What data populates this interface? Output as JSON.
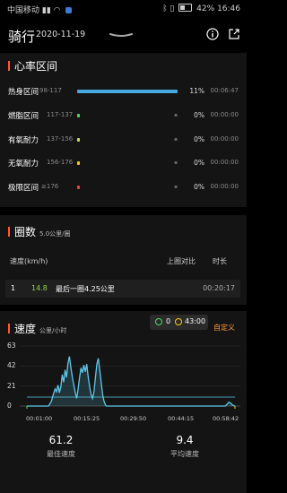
{
  "status_bar": {
    "carrier": "中国移动",
    "battery": "42%",
    "time": "16:46"
  },
  "header": {
    "title": "骑行",
    "date": "2020-11-19"
  },
  "heart_rate": {
    "title": "心率区间",
    "zones": [
      {
        "name": "热身区间",
        "range": "98-117",
        "percent": "11%",
        "time": "00:06:47",
        "color": "#4aa8e0",
        "fraction": 0.8
      },
      {
        "name": "燃脂区间",
        "range": "117-137",
        "percent": "0%",
        "time": "00:00:00",
        "color": "#4cd964",
        "fraction": 0.01
      },
      {
        "name": "有氧耐力",
        "range": "137-156",
        "percent": "0%",
        "time": "00:00:00",
        "color": "#c7e34a",
        "fraction": 0.01
      },
      {
        "name": "无氧耐力",
        "range": "156-176",
        "percent": "0%",
        "time": "00:00:00",
        "color": "#ffcc00",
        "fraction": 0.01
      },
      {
        "name": "极限区间",
        "range": "≥176",
        "percent": "0%",
        "time": "00:00:00",
        "color": "#ff3b30",
        "fraction": 0.01
      }
    ]
  },
  "laps": {
    "title": "圈数",
    "subtitle": "5.0公里/圈",
    "col_speed": "速度(km/h)",
    "col_compare": "上圈对比",
    "col_time": "时长",
    "rows": [
      {
        "index": "1",
        "speed": "14.8",
        "note": "最后一圈4.25公里",
        "time": "00:20:17"
      }
    ]
  },
  "speed": {
    "title": "速度",
    "unit": "公里/小时",
    "legend_a": "0",
    "legend_b": "43:00",
    "custom": "自定义",
    "best_value": "61.2",
    "best_label": "最佳速度",
    "avg_value": "9.4",
    "avg_label": "平均速度"
  },
  "chart_data": {
    "type": "area",
    "yticks": [
      "63",
      "42",
      "21",
      "0"
    ],
    "xticks": [
      "00:01:00",
      "00:15:25",
      "00:29:50",
      "00:44:15",
      "00:58:42"
    ],
    "ylim": [
      0,
      63
    ],
    "xlim": [
      1,
      58.7
    ],
    "reference_line": 9.4,
    "x": [
      1,
      7,
      7.8,
      8.3,
      8.8,
      9.2,
      9.6,
      10,
      10.4,
      10.8,
      11.2,
      11.6,
      12,
      12.4,
      12.8,
      13.2,
      13.6,
      14,
      14.4,
      14.8,
      15.2,
      15.6,
      16,
      16.4,
      16.8,
      17.2,
      17.6,
      18,
      18.4,
      18.8,
      19.2,
      19.6,
      20,
      20.4,
      20.8,
      21.2,
      21.6,
      22,
      22.4,
      22.8,
      23,
      30,
      56,
      56.5,
      57,
      57.5,
      58,
      58.7
    ],
    "y": [
      0,
      0,
      5,
      12,
      18,
      15,
      22,
      14,
      20,
      33,
      25,
      38,
      30,
      45,
      52,
      40,
      30,
      22,
      14,
      8,
      18,
      30,
      40,
      35,
      43,
      36,
      44,
      30,
      20,
      12,
      8,
      15,
      30,
      44,
      50,
      38,
      25,
      12,
      5,
      1,
      0,
      0,
      0,
      2,
      4,
      3,
      1,
      0
    ]
  }
}
